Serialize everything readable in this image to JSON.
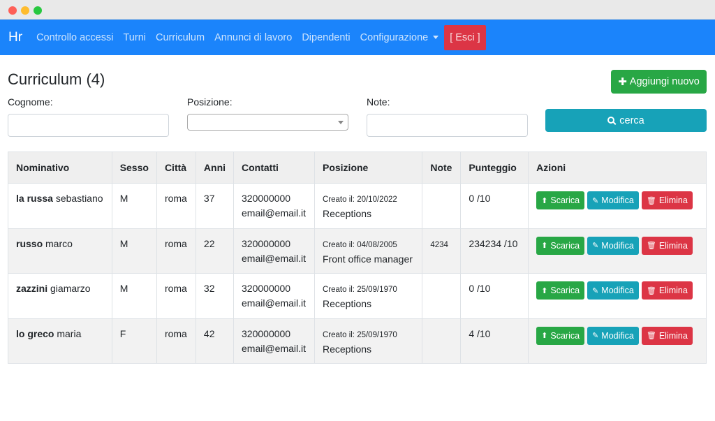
{
  "navbar": {
    "brand": "Hr",
    "links": [
      "Controllo accessi",
      "Turni",
      "Curriculum",
      "Annunci di lavoro",
      "Dipendenti"
    ],
    "dropdown_label": "Configurazione",
    "logout_label": "[ Esci ]"
  },
  "page": {
    "title": "Curriculum (4)",
    "add_button": "Aggiungi nuovo",
    "search_button": "cerca"
  },
  "filters": {
    "cognome_label": "Cognome:",
    "cognome_value": "",
    "posizione_label": "Posizione:",
    "posizione_value": "",
    "note_label": "Note:",
    "note_value": ""
  },
  "table": {
    "headers": [
      "Nominativo",
      "Sesso",
      "Città",
      "Anni",
      "Contatti",
      "Posizione",
      "Note",
      "Punteggio",
      "Azioni"
    ],
    "actions": {
      "download": "Scarica",
      "edit": "Modifica",
      "delete": "Elimina"
    },
    "rows": [
      {
        "surname": "la russa",
        "name": "sebastiano",
        "sex": "M",
        "city": "roma",
        "age": "37",
        "phone": "320000000",
        "email": "email@email.it",
        "created": "Creato il: 20/10/2022",
        "position": "Receptions",
        "note": "",
        "score": "0 /10"
      },
      {
        "surname": "russo",
        "name": "marco",
        "sex": "M",
        "city": "roma",
        "age": "22",
        "phone": "320000000",
        "email": "email@email.it",
        "created": "Creato il: 04/08/2005",
        "position": "Front office manager",
        "note": "4234",
        "score": "234234 /10"
      },
      {
        "surname": "zazzini",
        "name": "giamarzo",
        "sex": "M",
        "city": "roma",
        "age": "32",
        "phone": "320000000",
        "email": "email@email.it",
        "created": "Creato il: 25/09/1970",
        "position": "Receptions",
        "note": "",
        "score": "0 /10"
      },
      {
        "surname": "lo greco",
        "name": "maria",
        "sex": "F",
        "city": "roma",
        "age": "42",
        "phone": "320000000",
        "email": "email@email.it",
        "created": "Creato il: 25/09/1970",
        "position": "Receptions",
        "note": "",
        "score": "4 /10"
      }
    ]
  },
  "colors": {
    "navbar": "#1b84fb",
    "success": "#28a745",
    "info": "#17a2b8",
    "danger": "#dc3545"
  }
}
